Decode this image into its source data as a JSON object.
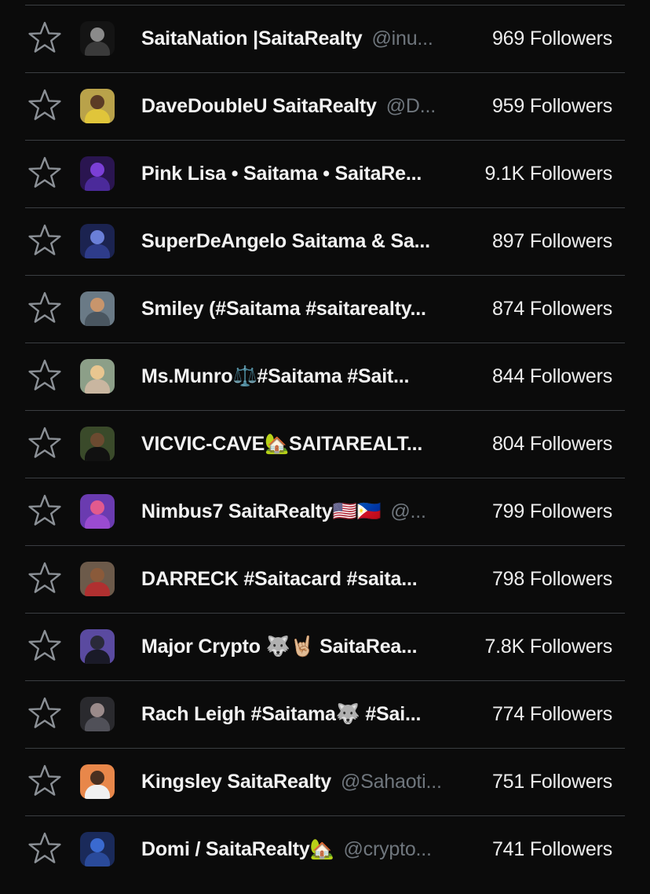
{
  "rows": [
    {
      "name": "SaitaNation |SaitaRealty",
      "handle": "@inu...",
      "followers": "969 Followers",
      "avatar": {
        "bg": "#141414",
        "head": "#8a8a8a",
        "torso": "#3a3a3a"
      }
    },
    {
      "name": "DaveDoubleU SaitaRealty",
      "handle": "@D...",
      "followers": "959 Followers",
      "avatar": {
        "bg": "#b9a24a",
        "head": "#5b3b25",
        "torso": "#e0c53a"
      }
    },
    {
      "name": "Pink Lisa • Saitama • SaitaRe...",
      "handle": "",
      "followers": "9.1K Followers",
      "avatar": {
        "bg": "#2a1550",
        "head": "#7b3fd6",
        "torso": "#4b2a9a"
      }
    },
    {
      "name": "SuperDeAngelo Saitama & Sa...",
      "handle": "",
      "followers": "897 Followers",
      "avatar": {
        "bg": "#1b2350",
        "head": "#6a7fd8",
        "torso": "#2e3c8a"
      }
    },
    {
      "name": "Smiley (#Saitama #saitarealty...",
      "handle": "",
      "followers": "874 Followers",
      "avatar": {
        "bg": "#6a7a86",
        "head": "#c8956c",
        "torso": "#4a5660"
      }
    },
    {
      "name": "Ms.Munro⚖️#Saitama #Sait...",
      "handle": "",
      "followers": "844 Followers",
      "avatar": {
        "bg": "#8c9f88",
        "head": "#e8c690",
        "torso": "#c9b6a0"
      }
    },
    {
      "name": "VICVIC-CAVE🏡SAITAREALT...",
      "handle": "",
      "followers": "804 Followers",
      "avatar": {
        "bg": "#3a4a2a",
        "head": "#6b4a30",
        "torso": "#111111"
      }
    },
    {
      "name": "Nimbus7 SaitaRealty🇺🇸🇵🇭",
      "handle": "@...",
      "followers": "799 Followers",
      "avatar": {
        "bg": "#6a3bb0",
        "head": "#e25a8e",
        "torso": "#9a4bd0"
      }
    },
    {
      "name": "DARRECK #Saitacard #saita...",
      "handle": "",
      "followers": "798 Followers",
      "avatar": {
        "bg": "#6c5a4a",
        "head": "#8a5a3a",
        "torso": "#b03030"
      }
    },
    {
      "name": "Major Crypto 🐺🤘🏼 SaitaRea...",
      "handle": "",
      "followers": "7.8K Followers",
      "avatar": {
        "bg": "#5a4aa0",
        "head": "#2a2a3a",
        "torso": "#1a1a28"
      }
    },
    {
      "name": "Rach Leigh #Saitama🐺 #Sai...",
      "handle": "",
      "followers": "774 Followers",
      "avatar": {
        "bg": "#2a2a2e",
        "head": "#9a8a8a",
        "torso": "#505058"
      }
    },
    {
      "name": "Kingsley SaitaRealty",
      "handle": "@Sahaoti...",
      "followers": "751 Followers",
      "avatar": {
        "bg": "#e8874a",
        "head": "#4a3020",
        "torso": "#f0f0f0"
      }
    },
    {
      "name": "Domi / SaitaRealty🏡",
      "handle": "@crypto...",
      "followers": "741 Followers",
      "avatar": {
        "bg": "#1a2a5a",
        "head": "#3a6ad0",
        "torso": "#2a4a9a"
      }
    }
  ]
}
